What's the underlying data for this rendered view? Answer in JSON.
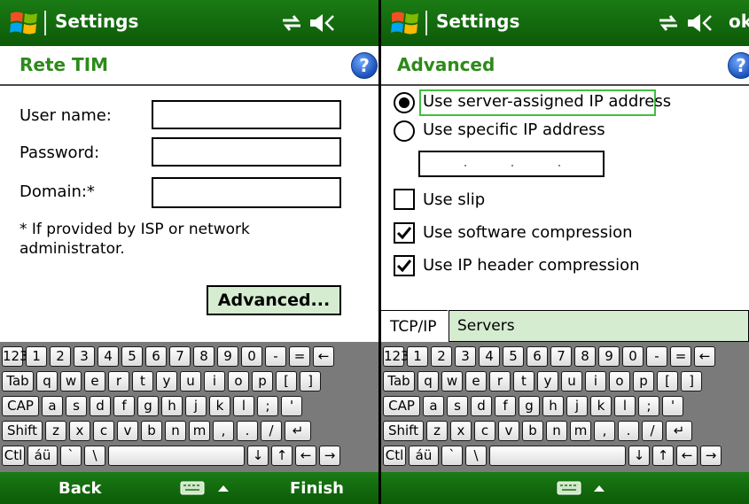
{
  "left": {
    "title": "Settings",
    "subhead": "Rete TIM",
    "help": "?",
    "fields": {
      "username_label": "User name:",
      "password_label": "Password:",
      "domain_label": "Domain:*"
    },
    "note": "* If provided by ISP or network administrator.",
    "advanced_button": "Advanced...",
    "softkeys": {
      "left": "Back",
      "right": "Finish"
    }
  },
  "right": {
    "title": "Settings",
    "ok": "ok",
    "subhead": "Advanced",
    "help": "?",
    "options": {
      "server_ip": "Use server-assigned IP address",
      "specific_ip": "Use specific IP address",
      "slip": "Use slip",
      "sw_compression": "Use software compression",
      "ip_header_compression": "Use IP header compression"
    },
    "selected_option": "server_ip",
    "checked": {
      "slip": false,
      "sw_compression": true,
      "ip_header_compression": true
    },
    "tabs": [
      "TCP/IP",
      "Servers"
    ]
  },
  "keyboard": {
    "row1": [
      "123",
      "1",
      "2",
      "3",
      "4",
      "5",
      "6",
      "7",
      "8",
      "9",
      "0",
      "-",
      "=",
      "←"
    ],
    "row2": [
      "Tab",
      "q",
      "w",
      "e",
      "r",
      "t",
      "y",
      "u",
      "i",
      "o",
      "p",
      "[",
      "]"
    ],
    "row3": [
      "CAP",
      "a",
      "s",
      "d",
      "f",
      "g",
      "h",
      "j",
      "k",
      "l",
      ";",
      "'"
    ],
    "row4": [
      "Shift",
      "z",
      "x",
      "c",
      "v",
      "b",
      "n",
      "m",
      ",",
      ".",
      "/",
      "↵"
    ],
    "row5": [
      "Ctl",
      "áü",
      "`",
      "\\",
      "",
      "↓",
      "↑",
      "←",
      "→"
    ]
  },
  "colors": {
    "titlebar": "#157012",
    "accent_green": "#2d8a1a",
    "button_bg": "#d5ecd0",
    "focus": "#3fbf3f"
  }
}
